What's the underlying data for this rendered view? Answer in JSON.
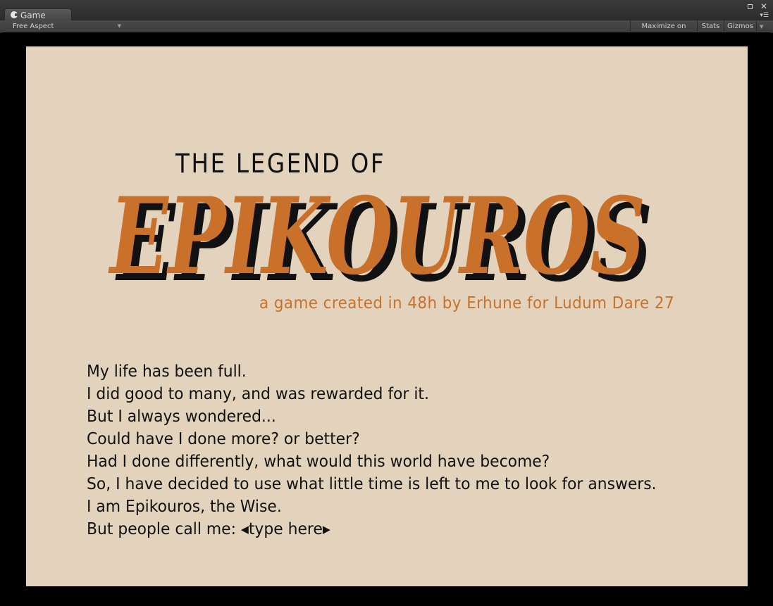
{
  "window": {
    "tab_title": "Game",
    "toolbar": {
      "aspect": "Free Aspect",
      "maximize_on_play": "Maximize on Play",
      "stats": "Stats",
      "gizmos": "Gizmos"
    }
  },
  "game": {
    "title_small": "THE LEGEND OF",
    "title_big": "EPIKOUROS",
    "subtitle": "a game created in 48h by Erhune for Ludum Dare 27",
    "story_lines": [
      "My life has been full.",
      "I did good to many, and was rewarded for it.",
      "But I always wondered...",
      "Could have I done more? or better?",
      "Had I done differently, what would this world have become?",
      "So, I have decided to use what little time is left to me to look for answers.",
      "I am Epikouros, the Wise."
    ],
    "name_prompt": "But people call me: ",
    "name_input_placeholder": "type here",
    "colors": {
      "background": "#e3d3bc",
      "accent": "#c9712a",
      "shadow": "#111111"
    }
  }
}
